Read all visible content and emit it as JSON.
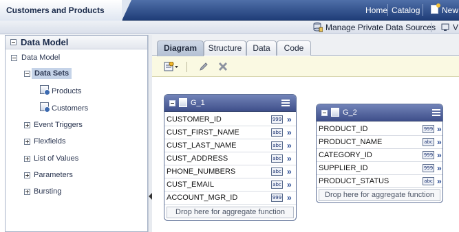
{
  "header": {
    "title": "Customers and Products",
    "links": [
      "Home",
      "Catalog",
      "New"
    ],
    "manage_label": "Manage Private Data Sources",
    "view_label": "V"
  },
  "left_panel": {
    "title": "Data Model",
    "tree": {
      "root": "Data Model",
      "data_sets": "Data Sets",
      "data_set_items": [
        "Products",
        "Customers"
      ],
      "others": [
        "Event Triggers",
        "Flexfields",
        "List of Values",
        "Parameters",
        "Bursting"
      ]
    }
  },
  "tabs": [
    {
      "label": "Diagram",
      "active": true
    },
    {
      "label": "Structure",
      "active": false
    },
    {
      "label": "Data",
      "active": false
    },
    {
      "label": "Code",
      "active": false
    }
  ],
  "toolbar": {
    "icons": [
      "new-dataset-icon",
      "edit-icon",
      "delete-icon"
    ]
  },
  "datasets": [
    {
      "name": "G_1",
      "fields": [
        {
          "name": "CUSTOMER_ID",
          "type": "999"
        },
        {
          "name": "CUST_FIRST_NAME",
          "type": "abc"
        },
        {
          "name": "CUST_LAST_NAME",
          "type": "abc"
        },
        {
          "name": "CUST_ADDRESS",
          "type": "abc"
        },
        {
          "name": "PHONE_NUMBERS",
          "type": "abc"
        },
        {
          "name": "CUST_EMAIL",
          "type": "abc"
        },
        {
          "name": "ACCOUNT_MGR_ID",
          "type": "999"
        }
      ],
      "dropzone": "Drop here for aggregate function"
    },
    {
      "name": "G_2",
      "fields": [
        {
          "name": "PRODUCT_ID",
          "type": "999"
        },
        {
          "name": "PRODUCT_NAME",
          "type": "abc"
        },
        {
          "name": "CATEGORY_ID",
          "type": "999"
        },
        {
          "name": "SUPPLIER_ID",
          "type": "999"
        },
        {
          "name": "PRODUCT_STATUS",
          "type": "abc"
        }
      ],
      "dropzone": "Drop here for aggregate function"
    }
  ],
  "colors": {
    "header_bar": "#2a4a86",
    "dataset_header": "#4f5f98",
    "toolbar_bg": "#faf9e2",
    "selected_node": "#c5d3e8"
  }
}
